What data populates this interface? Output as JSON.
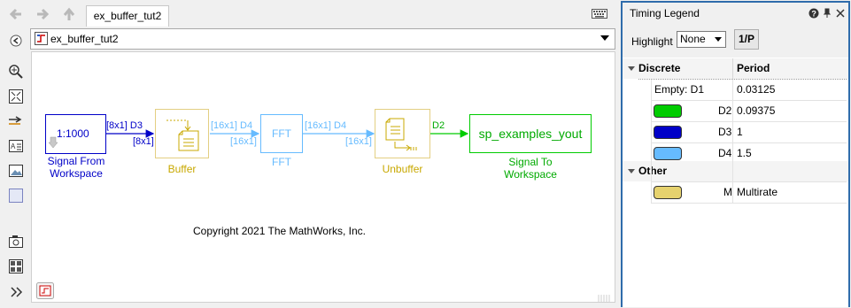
{
  "window": {
    "tab_label": "ex_buffer_tut2",
    "address": "ex_buffer_tut2"
  },
  "diagram": {
    "source_block": {
      "value": "1:1000",
      "name": "Signal From\nWorkspace"
    },
    "buffer_block": {
      "name": "Buffer"
    },
    "fft_block": {
      "text": "FFT",
      "name": "FFT"
    },
    "unbuffer_block": {
      "name": "Unbuffer"
    },
    "sink_block": {
      "text": "sp_examples_yout",
      "name": "Signal To\nWorkspace"
    },
    "signals": {
      "src_to_buf_top": "[8x1] D3",
      "src_to_buf_bottom": "[8x1]",
      "buf_to_fft_top": "[16x1] D4",
      "buf_to_fft_bottom": "[16x1]",
      "fft_to_unbuf_top": "[16x1] D4",
      "fft_to_unbuf_bottom": "[16x1]",
      "unbuf_to_sink": "D2"
    },
    "copyright": "Copyright 2021 The MathWorks, Inc."
  },
  "legend": {
    "title": "Timing Legend",
    "highlight_label": "Highlight",
    "highlight_value": "None",
    "period_button": "1/P",
    "groups": [
      {
        "name": "Discrete",
        "column": "Period",
        "rows": [
          {
            "label": "Empty: D1",
            "value": "0.03125",
            "color": ""
          },
          {
            "label": "D2",
            "value": "0.09375",
            "color": "#00cc00"
          },
          {
            "label": "D3",
            "value": "1",
            "color": "#0000c8"
          },
          {
            "label": "D4",
            "value": "1.5",
            "color": "#66bbff"
          }
        ]
      },
      {
        "name": "Other",
        "rows": [
          {
            "label": "M",
            "value": "Multirate",
            "color": "#e6d26e"
          }
        ]
      }
    ]
  },
  "colors": {
    "d2_green": "#00cc00",
    "d3_blue": "#0000c8",
    "d4_lightblue": "#66bbff",
    "multirate_yellow": "#e6d26e",
    "buffer_gold": "#c8a800"
  }
}
